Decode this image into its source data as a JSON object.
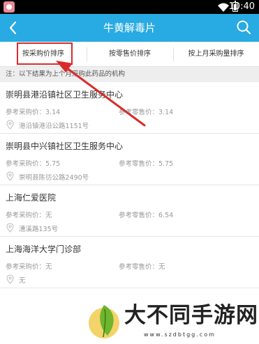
{
  "status_bar": {
    "time": "10:40"
  },
  "header": {
    "title": "牛黄解毒片",
    "back_icon": "back-chevron-icon",
    "search_icon": "search-icon"
  },
  "tabs": [
    {
      "label": "按采购价排序",
      "selected": true
    },
    {
      "label": "按零售价排序",
      "selected": false
    },
    {
      "label": "按上月采购量排序",
      "selected": false
    }
  ],
  "note": "注：以下结果为上个月采购此药品的机构",
  "items": [
    {
      "name": "崇明县港沿镇社区卫生服务中心",
      "purchase_price": "参考采购价：3.14",
      "retail_price": "参考零售价：3.14",
      "address": "港沿镇港沿公路1151号"
    },
    {
      "name": "崇明县中兴镇社区卫生服务中心",
      "purchase_price": "参考采购价：5.75",
      "retail_price": "参考零售价：5.75",
      "address": "崇明县陈彷公路2490号"
    },
    {
      "name": "上海仁爱医院",
      "purchase_price": "参考采购价：无",
      "retail_price": "参考零售价：6.54",
      "address": "漕溪路135号"
    },
    {
      "name": "上海海洋大学门诊部",
      "purchase_price": "参考采购价：无",
      "retail_price": "参考零售价：无",
      "address": "无"
    }
  ],
  "watermark": {
    "title": "大不同手游网",
    "url": "www.szdbtgg.com"
  },
  "colors": {
    "header_bg": "#28aae2",
    "highlight": "#d92b2b",
    "note_bg": "#eeeeee"
  }
}
